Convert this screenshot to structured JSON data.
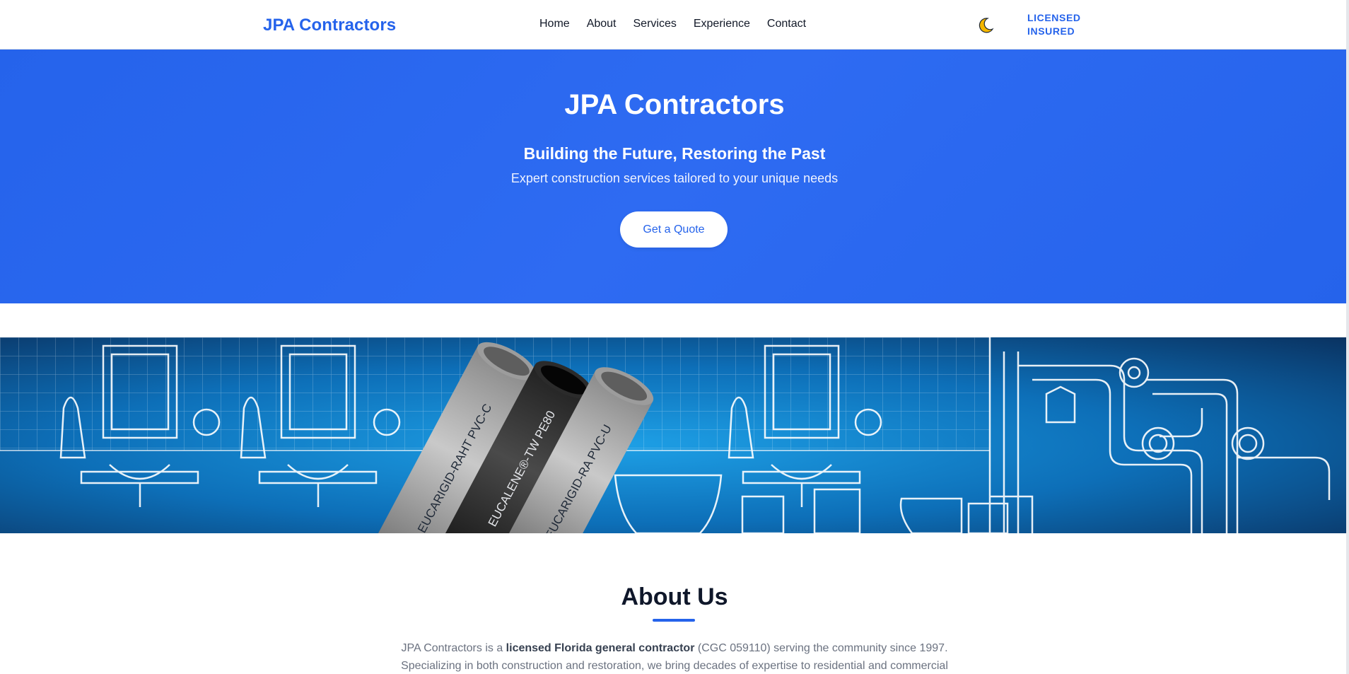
{
  "header": {
    "brand": "JPA Contractors",
    "nav": [
      "Home",
      "About",
      "Services",
      "Experience",
      "Contact"
    ],
    "badge_line1": "LICENSED",
    "badge_line2": "INSURED",
    "theme_icon": "moon-icon"
  },
  "hero": {
    "title": "JPA Contractors",
    "subtitle": "Building the Future, Restoring the Past",
    "text": "Expert construction services tailored to your unique needs",
    "cta": "Get a Quote"
  },
  "banner": {
    "pipe_labels": [
      "EUCARIGID-RAHT PVC-C",
      "EUCALENE®-TW PE80",
      "EUCARIGID-RA PVC-U"
    ],
    "colors": {
      "bg_dark": "#0a2f5c",
      "bg_mid": "#0d6fb8",
      "bg_light": "#1ea0e6"
    }
  },
  "about": {
    "title": "About Us",
    "line1_pre": "JPA Contractors is a ",
    "line1_bold": "licensed Florida general contractor",
    "line1_post": " (CGC 059110) serving the community since 1997.",
    "line2": "Specializing in both construction and restoration, we bring decades of expertise to residential and commercial"
  },
  "colors": {
    "accent": "#2563eb",
    "hero_bg": "#2563eb"
  }
}
